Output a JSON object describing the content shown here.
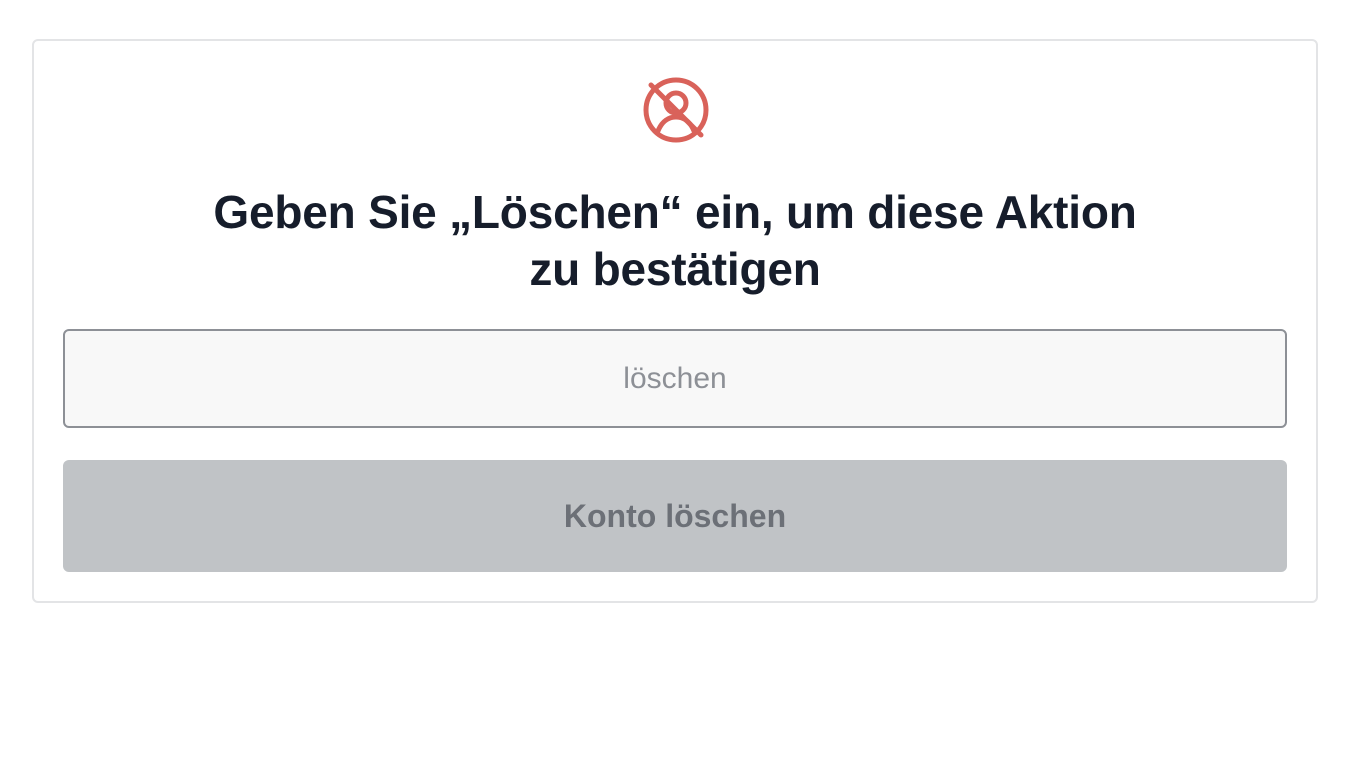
{
  "dialog": {
    "icon": "user-off-icon",
    "icon_color": "#d9625a",
    "title_line1": "Geben Sie „Löschen“ ein, um diese Aktion",
    "title_line2": "zu bestätigen",
    "confirm_input": {
      "value": "",
      "placeholder": "löschen"
    },
    "delete_button_label": "Konto löschen",
    "delete_button_disabled": true
  }
}
